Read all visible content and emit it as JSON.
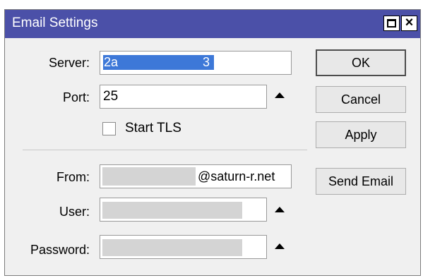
{
  "window": {
    "title": "Email Settings"
  },
  "titlebar": {
    "close_glyph": "×"
  },
  "server": {
    "label": "Server:",
    "value_start": "2a",
    "value_end": "3"
  },
  "port": {
    "label": "Port:",
    "value": "25"
  },
  "start_tls": {
    "label": "Start TLS",
    "checked": false
  },
  "from": {
    "label": "From:",
    "value_suffix": "@saturn-r.net"
  },
  "user": {
    "label": "User:"
  },
  "password": {
    "label": "Password:"
  },
  "buttons": {
    "ok": "OK",
    "cancel": "Cancel",
    "apply": "Apply",
    "send_email": "Send Email"
  },
  "icons": {
    "maximize": "maximize-icon",
    "close": "close-icon",
    "spinner": "triangle-up-icon"
  },
  "colors": {
    "titlebar": "#4b50a8",
    "selection": "#3d78d8",
    "window_bg": "#f0f0f0"
  }
}
